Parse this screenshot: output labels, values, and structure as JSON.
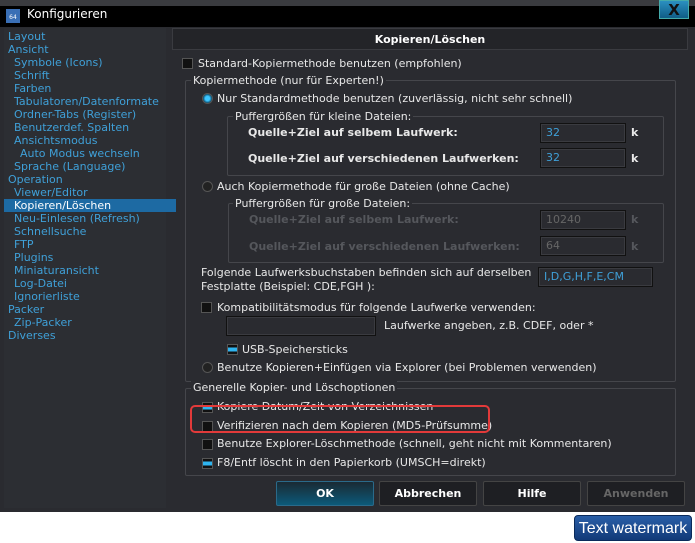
{
  "window": {
    "title": "Konfigurieren",
    "close_label": "X"
  },
  "sidebar": {
    "items": [
      {
        "label": "Layout",
        "level": 0
      },
      {
        "label": "Ansicht",
        "level": 0
      },
      {
        "label": "Symbole (Icons)",
        "level": 1
      },
      {
        "label": "Schrift",
        "level": 1
      },
      {
        "label": "Farben",
        "level": 1
      },
      {
        "label": "Tabulatoren/Datenformate",
        "level": 1
      },
      {
        "label": "Ordner-Tabs (Register)",
        "level": 1
      },
      {
        "label": "Benutzerdef. Spalten",
        "level": 1
      },
      {
        "label": "Ansichtsmodus",
        "level": 1
      },
      {
        "label": "Auto Modus wechseln",
        "level": 2
      },
      {
        "label": "Sprache (Language)",
        "level": 1
      },
      {
        "label": "Operation",
        "level": 0
      },
      {
        "label": "Viewer/Editor",
        "level": 1
      },
      {
        "label": "Kopieren/Löschen",
        "level": 1,
        "selected": true
      },
      {
        "label": "Neu-Einlesen (Refresh)",
        "level": 1
      },
      {
        "label": "Schnellsuche",
        "level": 1
      },
      {
        "label": "FTP",
        "level": 1
      },
      {
        "label": "Plugins",
        "level": 1
      },
      {
        "label": "Miniaturansicht",
        "level": 1
      },
      {
        "label": "Log-Datei",
        "level": 1
      },
      {
        "label": "Ignorierliste",
        "level": 1
      },
      {
        "label": "Packer",
        "level": 0
      },
      {
        "label": "Zip-Packer",
        "level": 1
      },
      {
        "label": "Diverses",
        "level": 0
      }
    ]
  },
  "panel": {
    "header": "Kopieren/Löschen",
    "standard_method": {
      "label": "Standard-Kopiermethode benutzen (empfohlen)",
      "checked": false
    },
    "method_group": {
      "title": "Kopiermethode (nur für Experten!)",
      "radio_standard": {
        "label": "Nur Standardmethode benutzen (zuverlässig, nicht sehr schnell)",
        "selected": true
      },
      "small_group": {
        "title": "Puffergrößen für kleine Dateien:",
        "same_label": "Quelle+Ziel auf selbem Laufwerk:",
        "same_value": "32",
        "diff_label": "Quelle+Ziel auf verschiedenen Laufwerken:",
        "diff_value": "32",
        "unit": "k"
      },
      "radio_large": {
        "label": "Auch Kopiermethode für große Dateien (ohne Cache)",
        "selected": false
      },
      "large_group": {
        "title": "Puffergrößen für große Dateien:",
        "same_label": "Quelle+Ziel auf selbem Laufwerk:",
        "same_value": "10240",
        "diff_label": "Quelle+Ziel auf verschiedenen Laufwerken:",
        "diff_value": "64",
        "unit": "k"
      },
      "same_disk_label_1": "Folgende Laufwerksbuchstaben befinden sich auf derselben",
      "same_disk_label_2": "Festplatte (Beispiel: CDE,FGH ):",
      "same_disk_value": "I,D,G,H,F,E,CM",
      "compat": {
        "label": "Kompatibilitätsmodus für folgende Laufwerke verwenden:",
        "checked": false,
        "value": "",
        "hint": "Laufwerke angeben, z.B. CDEF, oder *"
      },
      "usb": {
        "label": "USB-Speichersticks",
        "checked": true
      },
      "radio_explorer": {
        "label": "Benutze Kopieren+Einfügen via Explorer (bei Problemen verwenden)",
        "selected": false
      }
    },
    "general_group": {
      "title": "Generelle Kopier- und Löschoptionen",
      "options": [
        {
          "label": "Kopiere Datum/Zeit von Verzeichnissen",
          "checked": true
        },
        {
          "label": "Verifizieren nach dem Kopieren (MD5-Prüfsumme)",
          "checked": false
        },
        {
          "label": "Benutze Explorer-Löschmethode (schnell, geht nicht mit Kommentaren)",
          "checked": false
        },
        {
          "label": "F8/Entf löscht in den Papierkorb (UMSCH=direkt)",
          "checked": true
        }
      ]
    }
  },
  "buttons": {
    "ok": "OK",
    "cancel": "Abbrechen",
    "help": "Hilfe",
    "apply": "Anwenden"
  },
  "watermark": "Text watermark",
  "colors": {
    "accent": "#3fa0d8",
    "selection": "#1d6aa3",
    "highlight": "#e23a3a"
  }
}
